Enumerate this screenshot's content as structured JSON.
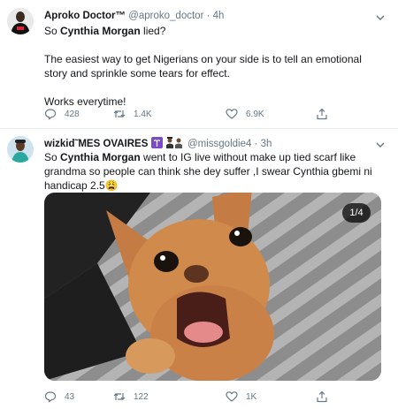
{
  "tweets": [
    {
      "name": "Aproko Doctor™",
      "handle": "@aproko_doctor",
      "separator": "·",
      "time": "4h",
      "line1_prefix": "So ",
      "line1_bold": "Cynthia Morgan",
      "line1_suffix": " lied?",
      "line2": "The easiest way to get Nigerians on your side is to tell an emotional story and sprinkle some tears for effect.",
      "line3": "Works everytime!",
      "replies": "428",
      "retweets": "1.4K",
      "likes": "6.9K"
    },
    {
      "name": "wizkid˜MES OVAIRES",
      "handle": "@missgoldie4",
      "separator": "·",
      "time": "3h",
      "text_prefix": "So ",
      "text_bold": "Cynthia Morgan",
      "text_suffix": " went to IG live without make up tied scarf like grandma so people can think she dey suffer ,I swear Cynthia gbemi ni handicap 2.5😩",
      "media_counter": "1/4",
      "replies": "43",
      "retweets": "122",
      "likes": "1K"
    }
  ],
  "icons": [
    "chevron-down-icon",
    "reply-icon",
    "retweet-icon",
    "like-icon",
    "share-icon",
    "aries-badge-icon",
    "crew-emoji-icon"
  ],
  "colors": {
    "text": "#14171a",
    "secondary": "#657786",
    "divider": "#e6ecf0",
    "badge": "#794bc4"
  }
}
